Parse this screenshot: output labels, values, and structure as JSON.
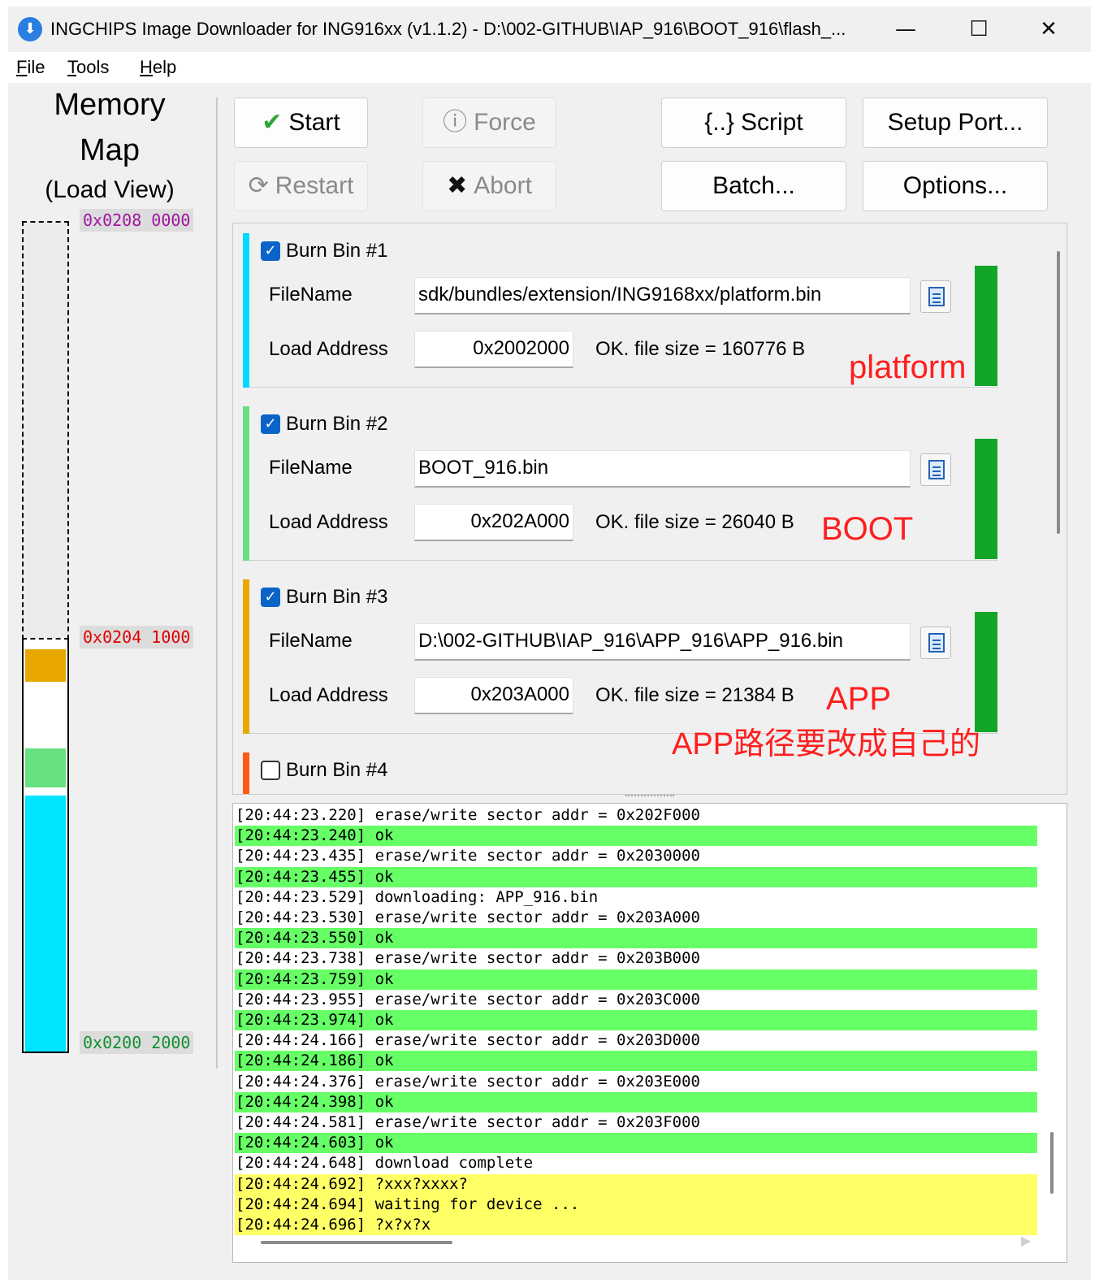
{
  "window": {
    "title": "INGCHIPS Image Downloader for ING916xx (v1.1.2)  - D:\\002-GITHUB\\IAP_916\\BOOT_916\\flash_...",
    "minimize": "—",
    "maximize": "☐",
    "close": "✕"
  },
  "menu": {
    "file": {
      "key": "F",
      "rest": "ile"
    },
    "tools": {
      "key": "T",
      "rest": "ools"
    },
    "help": {
      "key": "H",
      "rest": "elp"
    }
  },
  "memory_map": {
    "title_line1": "Memory",
    "title_line2": "Map",
    "title_line3": "(Load View)",
    "addresses": {
      "top": "0x0208 0000",
      "mid": "0x0204 1000",
      "bottom": "0x0200 2000"
    },
    "colors": {
      "app": "#e8a800",
      "boot": "#66e080",
      "platform": "#00e5ff",
      "addr_top": "#a0169f",
      "addr_mid": "#e00000",
      "addr_bottom": "#109030"
    }
  },
  "toolbar": {
    "start": {
      "icon": "✔",
      "label": "Start"
    },
    "force": {
      "icon": "ⓘ",
      "label": "Force"
    },
    "script": {
      "icon": "{..}",
      "label": "Script"
    },
    "setup_port": "Setup Port...",
    "restart": {
      "icon": "⟳",
      "label": "Restart"
    },
    "abort": {
      "icon": "✖",
      "label": "Abort"
    },
    "batch": "Batch...",
    "options": "Options..."
  },
  "bins": [
    {
      "label": "Burn Bin #1",
      "checked": true,
      "color": "#00d8ff",
      "filename_label": "FileName",
      "filename": "sdk/bundles/extension/ING9168xx/platform.bin",
      "load_label": "Load Address",
      "load_address": "0x2002000",
      "status": "OK. file size = 160776 B",
      "annotation": "platform"
    },
    {
      "label": "Burn Bin #2",
      "checked": true,
      "color": "#66e080",
      "filename_label": "FileName",
      "filename": "BOOT_916.bin",
      "load_label": "Load Address",
      "load_address": "0x202A000",
      "status": "OK. file size = 26040 B",
      "annotation": "BOOT"
    },
    {
      "label": "Burn Bin #3",
      "checked": true,
      "color": "#e8a800",
      "filename_label": "FileName",
      "filename": "D:\\002-GITHUB\\IAP_916\\APP_916\\APP_916.bin",
      "load_label": "Load Address",
      "load_address": "0x203A000",
      "status": "OK. file size = 21384 B",
      "annotation": "APP"
    },
    {
      "label": "Burn Bin #4",
      "checked": false,
      "color": "#ff5a14"
    }
  ],
  "annotation_app_path": "APP路径要改成自己的",
  "log": [
    {
      "t": "[20:44:23.220]",
      "m": "erase/write sector addr = 0x202F000",
      "k": "plain"
    },
    {
      "t": "[20:44:23.240]",
      "m": "ok",
      "k": "ok"
    },
    {
      "t": "[20:44:23.435]",
      "m": "erase/write sector addr = 0x2030000",
      "k": "plain"
    },
    {
      "t": "[20:44:23.455]",
      "m": "ok",
      "k": "ok"
    },
    {
      "t": "[20:44:23.529]",
      "m": "downloading: APP_916.bin",
      "k": "plain"
    },
    {
      "t": "[20:44:23.530]",
      "m": "erase/write sector addr = 0x203A000",
      "k": "plain"
    },
    {
      "t": "[20:44:23.550]",
      "m": "ok",
      "k": "ok"
    },
    {
      "t": "[20:44:23.738]",
      "m": "erase/write sector addr = 0x203B000",
      "k": "plain"
    },
    {
      "t": "[20:44:23.759]",
      "m": "ok",
      "k": "ok"
    },
    {
      "t": "[20:44:23.955]",
      "m": "erase/write sector addr = 0x203C000",
      "k": "plain"
    },
    {
      "t": "[20:44:23.974]",
      "m": "ok",
      "k": "ok"
    },
    {
      "t": "[20:44:24.166]",
      "m": "erase/write sector addr = 0x203D000",
      "k": "plain"
    },
    {
      "t": "[20:44:24.186]",
      "m": "ok",
      "k": "ok"
    },
    {
      "t": "[20:44:24.376]",
      "m": "erase/write sector addr = 0x203E000",
      "k": "plain"
    },
    {
      "t": "[20:44:24.398]",
      "m": "ok",
      "k": "ok"
    },
    {
      "t": "[20:44:24.581]",
      "m": "erase/write sector addr = 0x203F000",
      "k": "plain"
    },
    {
      "t": "[20:44:24.603]",
      "m": "ok",
      "k": "ok"
    },
    {
      "t": "[20:44:24.648]",
      "m": "download complete",
      "k": "plain"
    },
    {
      "t": "[20:44:24.692]",
      "m": "?xxx?xxxx?",
      "k": "warn"
    },
    {
      "t": "[20:44:24.694]",
      "m": "waiting for device ...",
      "k": "warn"
    },
    {
      "t": "[20:44:24.696]",
      "m": "?x?x?x",
      "k": "warn"
    }
  ]
}
